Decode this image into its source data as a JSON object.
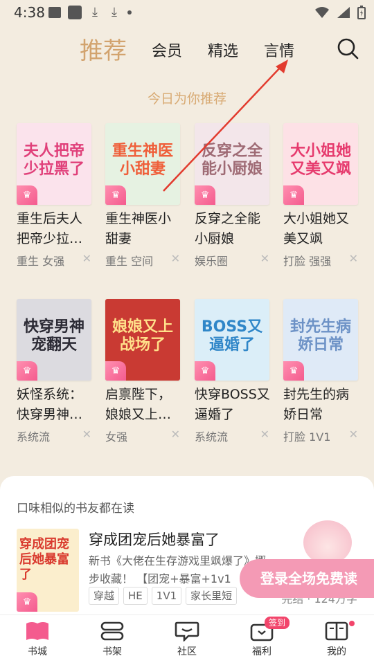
{
  "status_bar": {
    "time": "4:38"
  },
  "nav": {
    "main": "推荐",
    "tabs": [
      "会员",
      "精选",
      "言情"
    ]
  },
  "subtitle": "今日为你推荐",
  "books": [
    {
      "title": "重生后夫人把帝少拉…",
      "cover_text": "夫人把帝少拉黑了",
      "tags": "重生 女强",
      "cover_color": "#fbe3ec",
      "text_color": "#e0407a"
    },
    {
      "title": "重生神医小甜妻",
      "cover_text": "重生神医小甜妻",
      "tags": "重生 空间",
      "cover_color": "#e6f2e2",
      "text_color": "#ef5f3a"
    },
    {
      "title": "反穿之全能小厨娘",
      "cover_text": "反穿之全能小厨娘",
      "tags": "娱乐圈",
      "cover_color": "#f3e6ea",
      "text_color": "#9e6a74"
    },
    {
      "title": "大小姐她又美又飒",
      "cover_text": "大小姐她又美又飒",
      "tags": "打脸 强强",
      "cover_color": "#fde1e6",
      "text_color": "#e63a6d"
    },
    {
      "title": "妖怪系统：快穿男神…",
      "cover_text": "快穿男神宠翻天",
      "tags": "系统流",
      "cover_color": "#dcdbe0",
      "text_color": "#2b2a34"
    },
    {
      "title": "启禀陛下，娘娘又上…",
      "cover_text": "娘娘又上战场了",
      "tags": "女强",
      "cover_color": "#c93a33",
      "text_color": "#ffe08a"
    },
    {
      "title": "快穿BOSS又逼婚了",
      "cover_text": "BOSS又逼婚了",
      "tags": "系统流",
      "cover_color": "#dbeef8",
      "text_color": "#2f86c8"
    },
    {
      "title": "封先生的病娇日常",
      "cover_text": "封先生病娇日常",
      "tags": "打脸 1V1",
      "cover_color": "#dfeaf7",
      "text_color": "#6d92c6"
    }
  ],
  "panel": {
    "title": "口味相似的书友都在读",
    "book": {
      "title": "穿成团宠后她暴富了",
      "cover_text": "穿成团宠后她暴富了",
      "desc": "新书《大佬在生存游戏里飒爆了》挪步收藏！ 【团宠+暴富+1v1",
      "tags": [
        "穿越",
        "HE",
        "1V1",
        "家长里短"
      ],
      "status": "完结 · 124万字"
    }
  },
  "promo": "登录全场免费读",
  "tabbar": {
    "items": [
      "书城",
      "书架",
      "社区",
      "福利",
      "我的"
    ],
    "badge": "签到"
  }
}
